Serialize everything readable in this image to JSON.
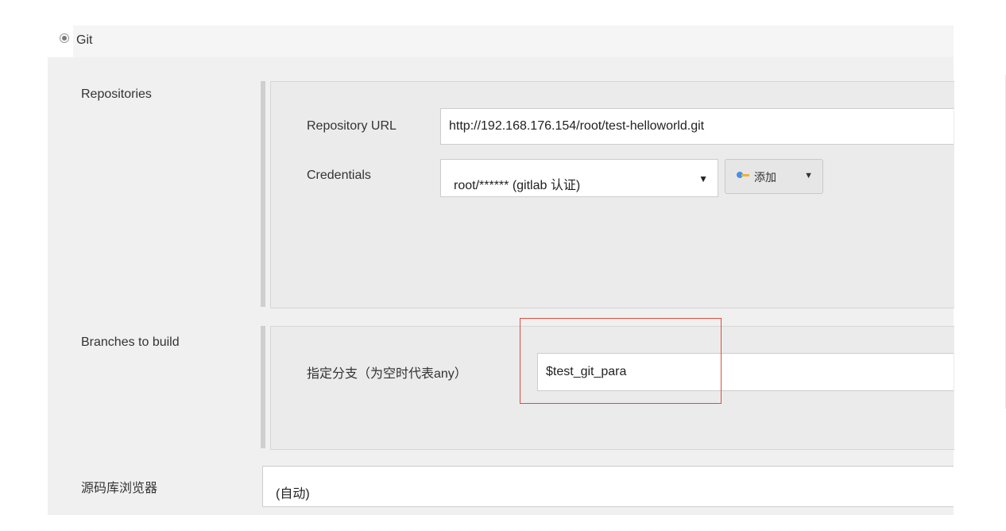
{
  "scm": {
    "option_label": "Git",
    "selected": true
  },
  "repositories": {
    "label": "Repositories",
    "url_label": "Repository URL",
    "url_value": "http://192.168.176.154/root/test-helloworld.git",
    "credentials_label": "Credentials",
    "credentials_value": "root/****** (gitlab 认证)",
    "add_button_label": "添加"
  },
  "branches": {
    "label": "Branches to build",
    "specifier_label": "指定分支（为空时代表any）",
    "specifier_value": "$test_git_para"
  },
  "browser": {
    "label": "源码库浏览器",
    "value": "(自动)"
  },
  "colors": {
    "highlight": "#e04b3f",
    "panel_bg": "#ebebeb",
    "section_bg": "#f0f0f0"
  },
  "icons": {
    "radio": "radio-selected",
    "add": "key-icon",
    "dropdown": "caret-down-icon"
  }
}
